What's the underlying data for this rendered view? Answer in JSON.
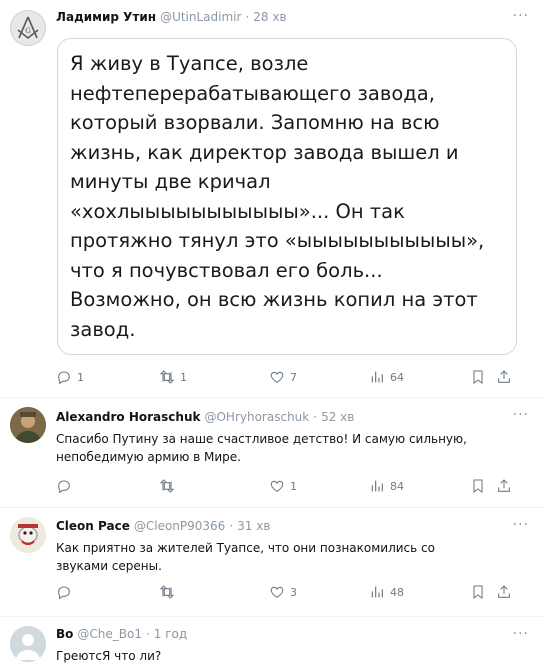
{
  "tweets": [
    {
      "name": "Ладимир Утин",
      "handle": "@UtinLadimir",
      "dot": "·",
      "time": "28 хв",
      "image_text_lines": [
        "Я живу в Туапсе, возле",
        "нефтеперерабатывающего завода,",
        "который взорвали. Запомню на всю",
        "жизнь, как директор завода вышел и",
        "минуты две кричал",
        "«хохлыыыыыыыыыыы»... Он так",
        "протяжно тянул это «ыыыыыыыыыыы»,",
        "что я почувствовал его боль...",
        "Возможно, он всю жизнь копил на этот",
        "завод."
      ],
      "replies": "1",
      "retweets": "1",
      "likes": "7",
      "views": "64"
    },
    {
      "name": "Alexandro Horaschuk",
      "handle": "@OHryhoraschuk",
      "dot": "·",
      "time": "52 хв",
      "text": "Спасибо Путину за наше счастливое детство!  И самую сильную, непобедимую армию в Мире.",
      "replies": "",
      "retweets": "",
      "likes": "1",
      "views": "84"
    },
    {
      "name": "Cleon Pace",
      "handle": "@CleonP90366",
      "dot": "·",
      "time": "31 хв",
      "text": "Как приятно за жителей Туапсе, что они познакомились со звуками серены.",
      "replies": "",
      "retweets": "",
      "likes": "3",
      "views": "48"
    },
    {
      "name": "Bo",
      "handle": "@Che_Bo1",
      "dot": "·",
      "time": "1 год",
      "text": "ГреютсЯ что ли?"
    }
  ],
  "icons": {
    "more": "more-icon",
    "reply": "reply-icon",
    "retweet": "retweet-icon",
    "like": "heart-icon",
    "views": "views-icon",
    "bookmark": "bookmark-icon",
    "share": "share-icon"
  },
  "more_glyph": "···",
  "colors": {
    "text": "#0f1419",
    "secondary": "#8b98a5",
    "divider": "#eff3f4",
    "card_border": "#cfd9de"
  }
}
